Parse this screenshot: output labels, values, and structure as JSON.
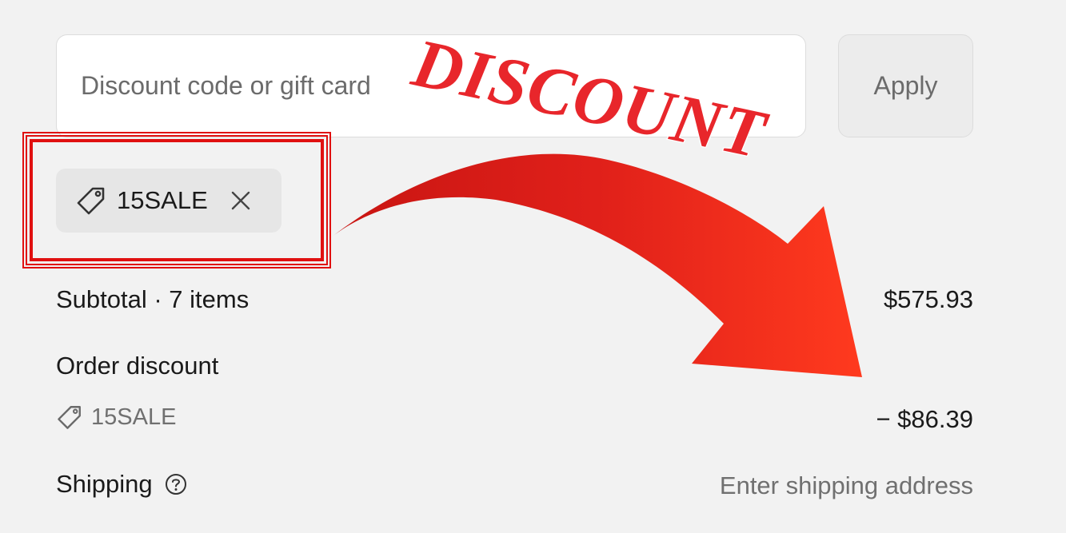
{
  "discount_form": {
    "placeholder": "Discount code or gift card",
    "value": "",
    "apply_label": "Apply"
  },
  "applied_code": {
    "code": "15SALE",
    "icon": "tag-icon",
    "remove_icon": "close-icon"
  },
  "summary": {
    "subtotal_label": "Subtotal · 7 items",
    "subtotal_value": "$575.93",
    "order_discount_label": "Order discount",
    "discount_code": "15SALE",
    "discount_value": "− $86.39",
    "shipping_label": "Shipping",
    "shipping_value": "Enter shipping address",
    "shipping_help_icon": "help-icon"
  },
  "overlay": {
    "headline": "DISCOUNT",
    "headline_color": "#e8262b",
    "arrow_color": "#ef2a1c",
    "highlight_color": "#e01010"
  }
}
